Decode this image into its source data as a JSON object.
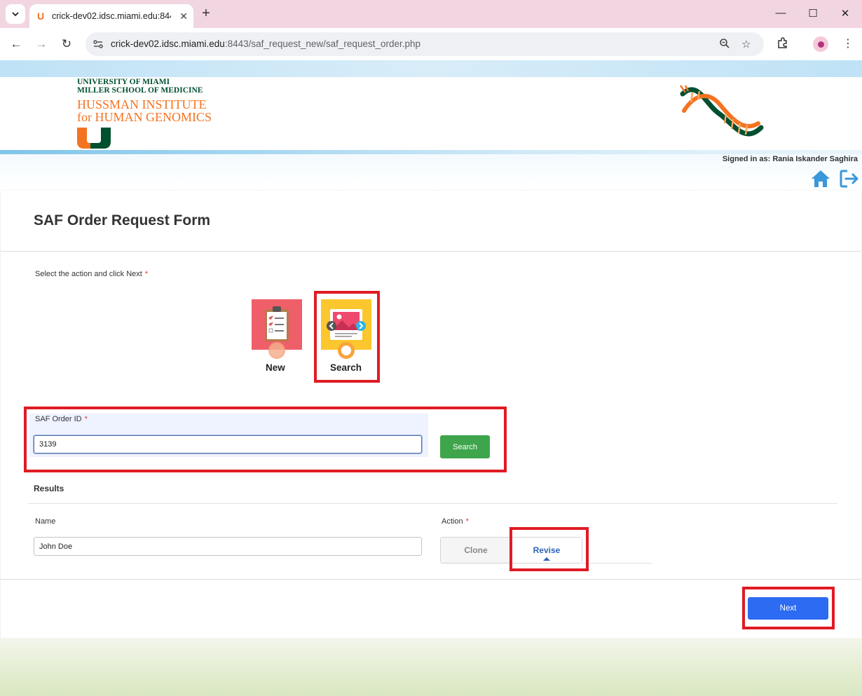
{
  "browser": {
    "tab_title": "crick-dev02.idsc.miami.edu:8443",
    "new_tab": "+",
    "url_host": "crick-dev02.idsc.miami.edu",
    "url_rest": ":8443/saf_request_new/saf_request_order.php"
  },
  "header": {
    "um_line1": "UNIVERSITY OF MIAMI",
    "um_line2": "MILLER SCHOOL OF MEDICINE",
    "hi_line1": "HUSSMAN INSTITUTE",
    "hi_line2": "for HUMAN GENOMICS",
    "signed_in": "Signed in as: Rania Iskander Saghira"
  },
  "form": {
    "title": "SAF Order Request Form",
    "action_prompt": "Select the action and click Next",
    "required_mark": "*",
    "options": [
      {
        "label": "New",
        "selected": false
      },
      {
        "label": "Search",
        "selected": true
      }
    ],
    "order_id_label": "SAF Order ID",
    "order_id_value": "3139",
    "search_button": "Search",
    "results_title": "Results",
    "name_label": "Name",
    "name_value": "John Doe",
    "action_label": "Action",
    "action_options": [
      "Clone",
      "Revise"
    ],
    "action_selected": "Revise",
    "next_button": "Next"
  },
  "colors": {
    "tab_strip": "#f1d6e2",
    "um_green": "#005030",
    "um_orange": "#f47321",
    "search_green": "#3fa54d",
    "next_blue": "#2c6bf2",
    "highlight_red": "#e01b24"
  }
}
